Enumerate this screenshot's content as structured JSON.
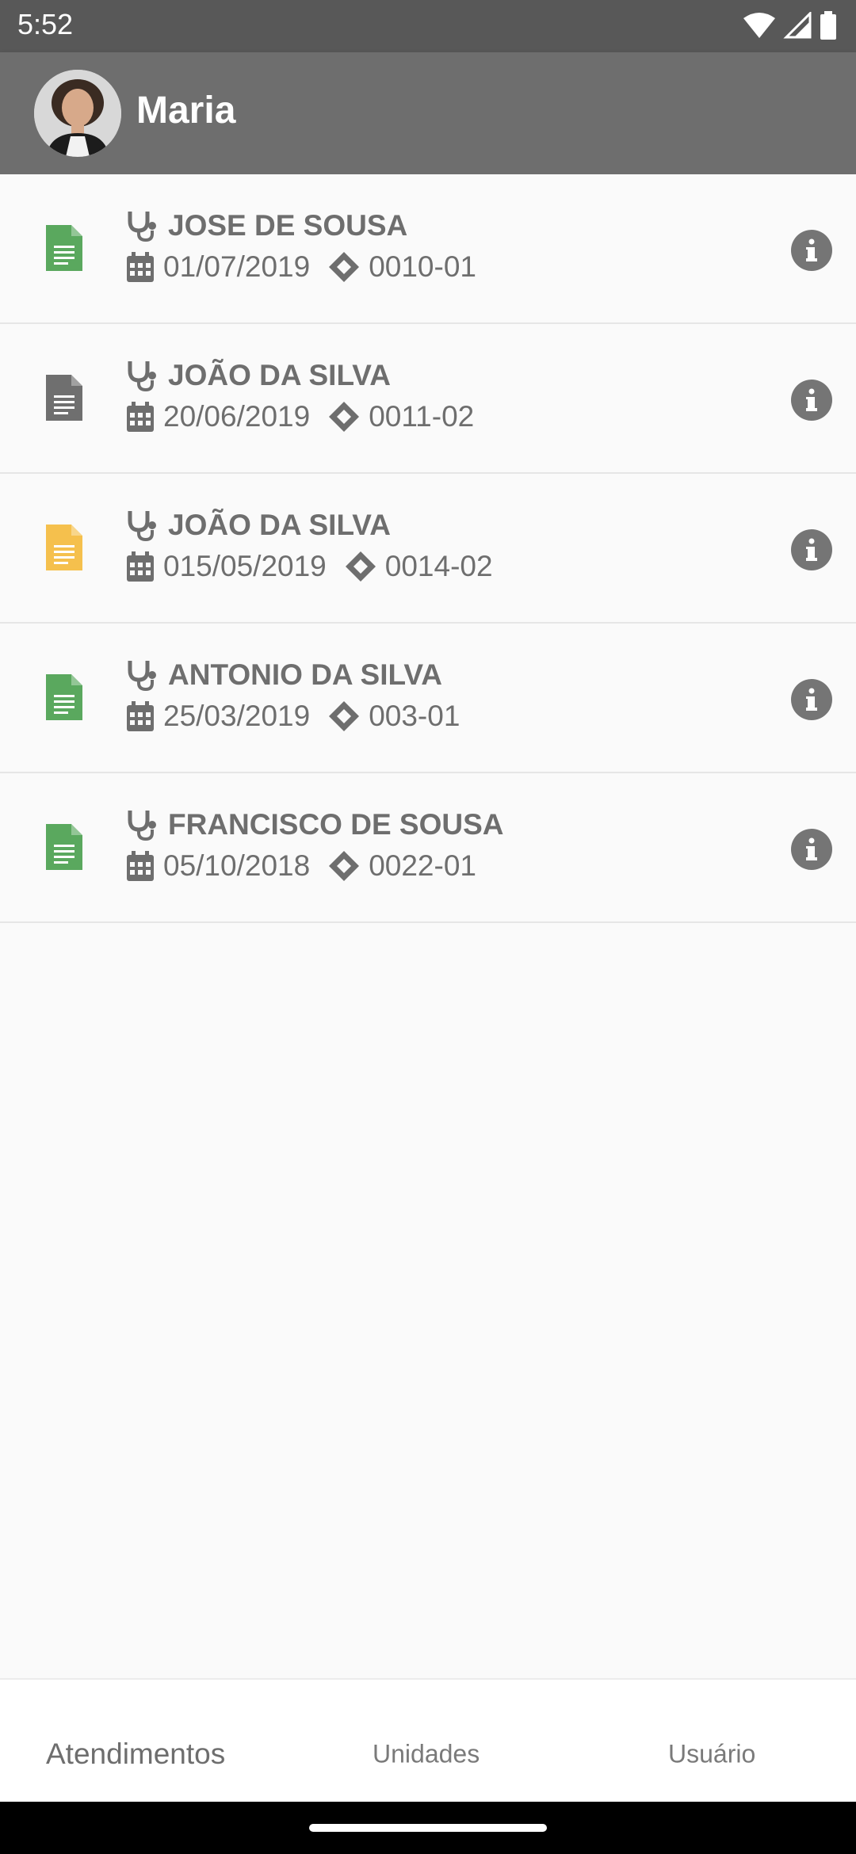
{
  "status_bar": {
    "time": "5:52"
  },
  "header": {
    "user_name": "Maria"
  },
  "colors": {
    "green_doc": "#5aa85e",
    "gray_doc": "#6f6f6f",
    "yellow_doc": "#f5c04d"
  },
  "appointments": [
    {
      "doc_color": "#5aa85e",
      "patient": "JOSE DE SOUSA",
      "date": "01/07/2019",
      "code": "0010-01"
    },
    {
      "doc_color": "#6f6f6f",
      "patient": "JOÃO DA SILVA",
      "date": "20/06/2019",
      "code": "0011-02"
    },
    {
      "doc_color": "#f5c04d",
      "patient": "JOÃO DA SILVA",
      "date": "015/05/2019",
      "code": "0014-02"
    },
    {
      "doc_color": "#5aa85e",
      "patient": "ANTONIO DA SILVA",
      "date": "25/03/2019",
      "code": "003-01"
    },
    {
      "doc_color": "#5aa85e",
      "patient": "FRANCISCO DE SOUSA",
      "date": "05/10/2018",
      "code": "0022-01"
    }
  ],
  "bottom_nav": {
    "tab1": "Atendimentos",
    "tab2": "Unidades",
    "tab3": "Usuário"
  },
  "icons": {
    "doc": "document-icon",
    "stethoscope": "stethoscope-icon",
    "calendar": "calendar-icon",
    "ticket": "ticket-icon",
    "info": "info-icon"
  }
}
